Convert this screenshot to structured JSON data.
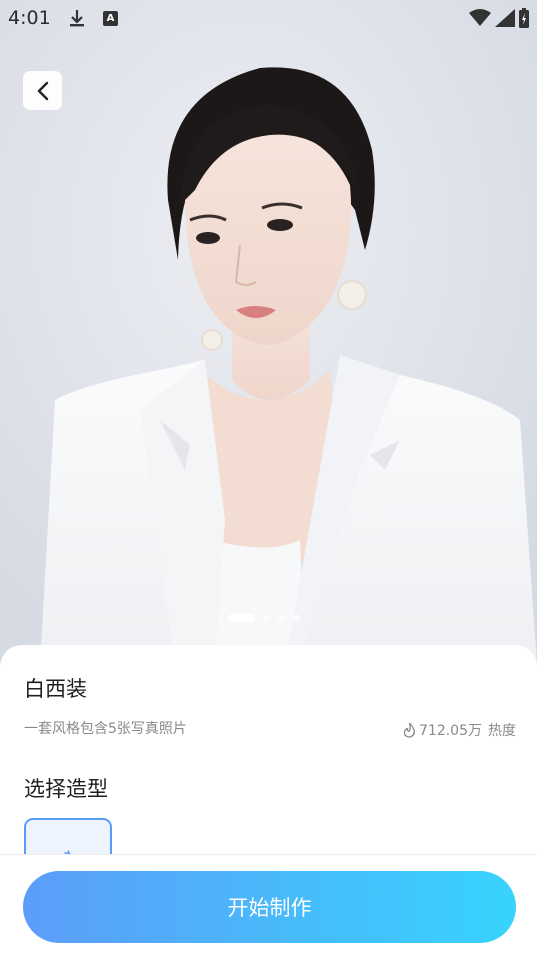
{
  "status_bar": {
    "time": "4:01",
    "icons": [
      "download-icon",
      "a-badge-icon",
      "wifi-icon",
      "signal-icon",
      "battery-icon"
    ]
  },
  "hero": {
    "slide_count": 4,
    "active_slide": 1
  },
  "style": {
    "title": "白西装",
    "description": "一套风格包含5张写真照片",
    "heat_value": "712.05万",
    "heat_label": "热度"
  },
  "section": {
    "title": "选择造型"
  },
  "actions": {
    "start_label": "开始制作"
  },
  "colors": {
    "accent_start": "#5c9dfa",
    "accent_end": "#37d3fc",
    "card_border": "#5a9cf5"
  }
}
